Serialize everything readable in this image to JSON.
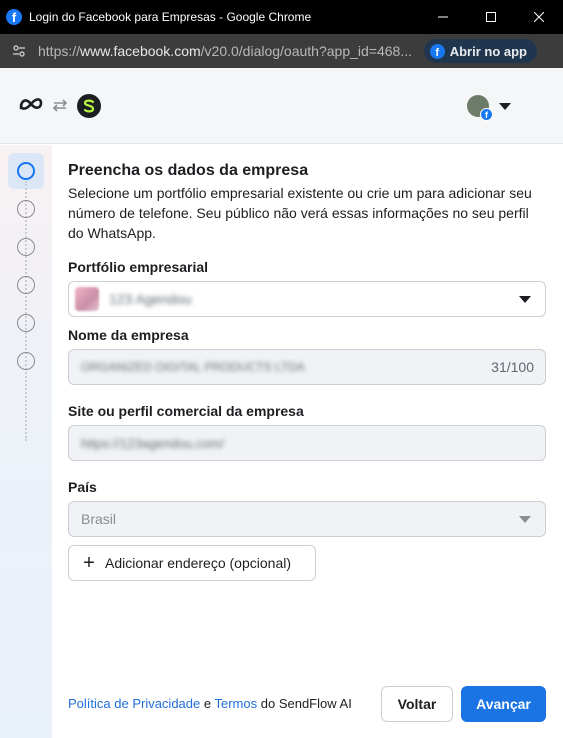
{
  "browser": {
    "window_title": "Login do Facebook para Empresas - Google Chrome",
    "url_prefix": "https://",
    "url_domain": "www.facebook.com",
    "url_path": "/v20.0/dialog/oauth?app_id=468...",
    "open_app_label": "Abrir no app"
  },
  "header": {
    "logo": "meta-logo",
    "app_logo_letter": "S"
  },
  "stepper": {
    "total_steps": 6,
    "active_step": 1
  },
  "form": {
    "title": "Preencha os dados da empresa",
    "description": "Selecione um portfólio empresarial existente ou crie um para adicionar seu número de telefone. Seu público não verá essas informações no seu perfil do WhatsApp.",
    "portfolio_label": "Portfólio empresarial",
    "portfolio_value": "123 Agendou",
    "company_name_label": "Nome da empresa",
    "company_name_value": "ORGANIZED DIGITAL PRODUCTS LTDA",
    "company_name_counter": "31/100",
    "website_label": "Site ou perfil comercial da empresa",
    "website_value": "https://123agendou.com/",
    "country_label": "País",
    "country_value": "Brasil",
    "add_address_label": "Adicionar endereço (opcional)"
  },
  "footer": {
    "privacy_link": "Política de Privacidade",
    "and_text": "e",
    "terms_link": "Termos",
    "of_text": "do SendFlow AI",
    "back_button": "Voltar",
    "next_button": "Avançar"
  },
  "colors": {
    "primary": "#1b74e4",
    "link": "#216fdb",
    "titlebar": "#000000",
    "addressbar": "#3c3c3c"
  }
}
